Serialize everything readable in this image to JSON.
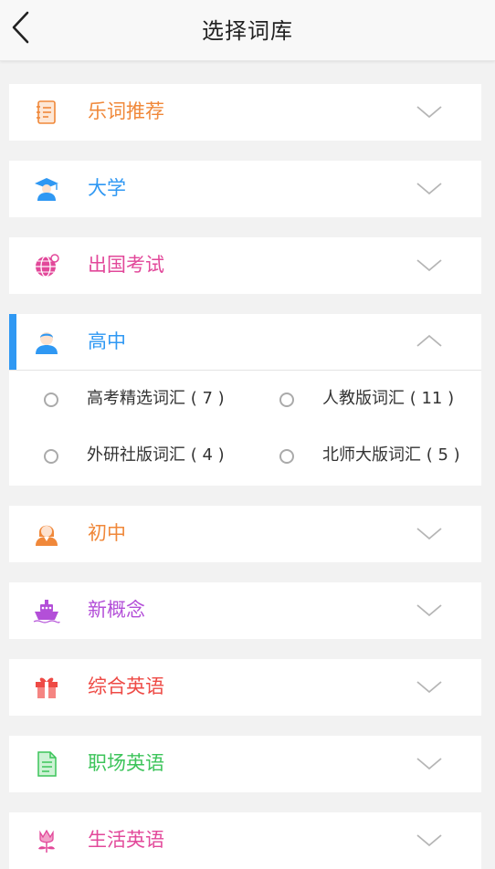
{
  "header": {
    "title": "选择词库",
    "back_icon": "chevron-left-icon"
  },
  "categories": [
    {
      "label": "乐词推荐",
      "icon": "notebook-icon",
      "color": "#f0883a",
      "expanded": false
    },
    {
      "label": "大学",
      "icon": "graduate-icon",
      "color": "#2f98f3",
      "expanded": false
    },
    {
      "label": "出国考试",
      "icon": "globe-icon",
      "color": "#e2489a",
      "expanded": false
    },
    {
      "label": "高中",
      "icon": "student-boy-icon",
      "color": "#2f98f3",
      "expanded": true,
      "options": [
        {
          "label": "高考精选词汇 ( 7 )"
        },
        {
          "label": "人教版词汇 ( 11 )"
        },
        {
          "label": "外研社版词汇 ( 4 )"
        },
        {
          "label": "北师大版词汇 ( 5 )"
        }
      ]
    },
    {
      "label": "初中",
      "icon": "student-girl-icon",
      "color": "#f0883a",
      "expanded": false
    },
    {
      "label": "新概念",
      "icon": "ship-icon",
      "color": "#b34fd8",
      "expanded": false
    },
    {
      "label": "综合英语",
      "icon": "gift-icon",
      "color": "#ee4a45",
      "expanded": false
    },
    {
      "label": "职场英语",
      "icon": "document-icon",
      "color": "#3cc45a",
      "expanded": false
    },
    {
      "label": "生活英语",
      "icon": "flower-icon",
      "color": "#e2489a",
      "expanded": false
    }
  ],
  "colors": {
    "background": "#f2f2f2",
    "card": "#ffffff",
    "active_accent": "#2f98f3",
    "chevron": "#b5b5b5"
  }
}
